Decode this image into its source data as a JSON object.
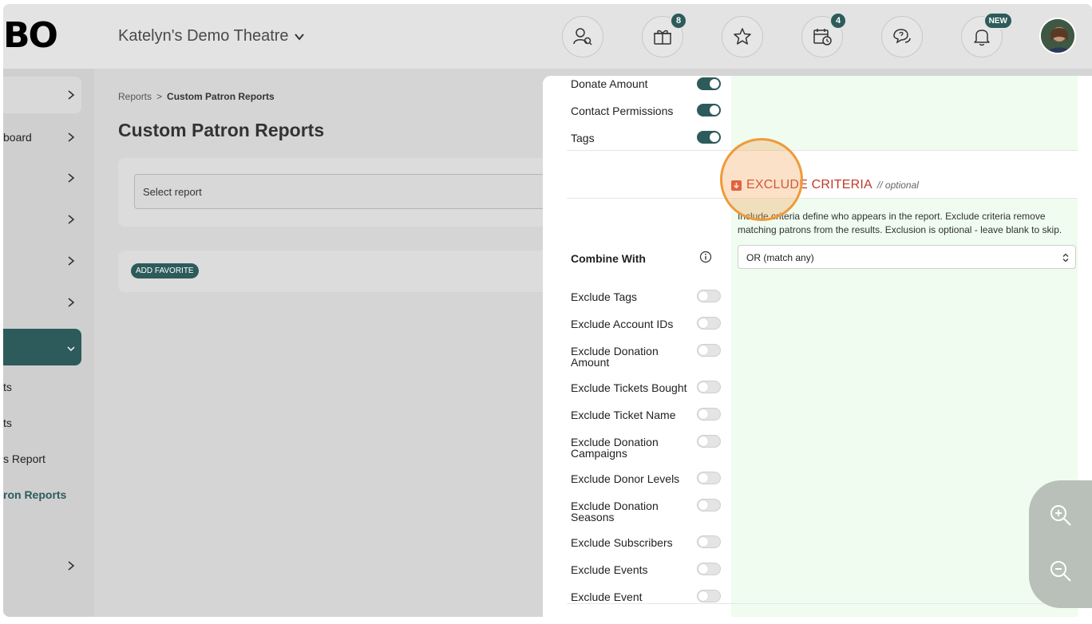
{
  "app": {
    "logo_text": "BO",
    "venue_name": "Katelyn's Demo Theatre"
  },
  "topbar": {
    "icons": [
      {
        "name": "patron-search-icon",
        "badge": ""
      },
      {
        "name": "gift-box-icon",
        "badge": "8"
      },
      {
        "name": "star-icon",
        "badge": ""
      },
      {
        "name": "calendar-clock-icon",
        "badge": "4"
      },
      {
        "name": "chat-help-icon",
        "badge": ""
      },
      {
        "name": "bell-icon",
        "badge": "NEW"
      }
    ]
  },
  "sidebar": {
    "items": [
      {
        "label": ""
      },
      {
        "label": "board"
      },
      {
        "label": ""
      },
      {
        "label": ""
      },
      {
        "label": ""
      },
      {
        "label": ""
      },
      {
        "label": ""
      }
    ],
    "sub_items": [
      {
        "label": "ts"
      },
      {
        "label": "ts"
      },
      {
        "label": "s Report"
      },
      {
        "label": "ron Reports"
      }
    ],
    "last_item": {
      "label": ""
    }
  },
  "main": {
    "breadcrumb_root": "Reports",
    "breadcrumb_separator": ">",
    "breadcrumb_current": "Custom Patron Reports",
    "page_title": "Custom Patron Reports",
    "select_report_placeholder": "Select report",
    "add_favorite_label": "ADD FAVORITE"
  },
  "panel": {
    "include_rows": [
      {
        "label": "Donate Amount",
        "on": true
      },
      {
        "label": "Contact Permissions",
        "on": true
      },
      {
        "label": "Tags",
        "on": true
      }
    ],
    "exclude_section": {
      "title": "EXCLUDE CRITERIA",
      "optional_label": "// optional",
      "description": "Include criteria define who appears in the report. Exclude criteria remove matching patrons from the results. Exclusion is optional - leave blank to skip."
    },
    "combine_with": {
      "label": "Combine With",
      "selected": "OR (match any)"
    },
    "exclude_rows": [
      {
        "label": "Exclude Tags",
        "on": false
      },
      {
        "label": "Exclude Account IDs",
        "on": false
      },
      {
        "label": "Exclude Donation Amount",
        "on": false
      },
      {
        "label": "Exclude Tickets Bought",
        "on": false
      },
      {
        "label": "Exclude Ticket Name",
        "on": false
      },
      {
        "label": "Exclude Donation Campaigns",
        "on": false
      },
      {
        "label": "Exclude Donor Levels",
        "on": false
      },
      {
        "label": "Exclude Donation Seasons",
        "on": false
      },
      {
        "label": "Exclude Subscribers",
        "on": false
      },
      {
        "label": "Exclude Events",
        "on": false
      },
      {
        "label": "Exclude Event",
        "on": false
      }
    ]
  },
  "zoom": {
    "zoom_in_icon": "zoom-in-icon",
    "zoom_out_icon": "zoom-out-icon"
  },
  "colors": {
    "brand_teal": "#2d5b5b",
    "exclude_red": "#c0392b",
    "highlight_orange": "#ef9a3a",
    "panel_green": "#effcef"
  }
}
